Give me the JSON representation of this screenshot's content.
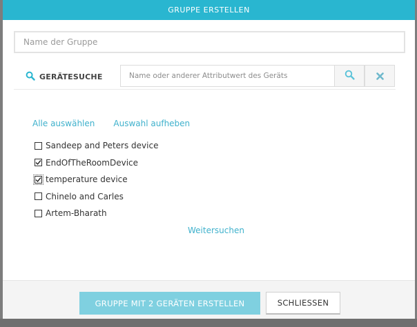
{
  "dialog": {
    "title": "GRUPPE ERSTELLEN",
    "group_name_placeholder": "Name der Gruppe",
    "search": {
      "label": "GERÄTESUCHE",
      "placeholder": "Name oder anderer Attributwert des Geräts",
      "search_icon": "search-icon",
      "clear_icon": "close-icon"
    },
    "select_all_label": "Alle auswählen",
    "deselect_label": "Auswahl aufheben",
    "devices": [
      {
        "name": "Sandeep and Peters device",
        "checked": false
      },
      {
        "name": "EndOfTheRoomDevice",
        "checked": true
      },
      {
        "name": "temperature device",
        "checked": true
      },
      {
        "name": "Chinelo and Carles",
        "checked": false
      },
      {
        "name": "Artem-Bharath",
        "checked": false
      }
    ],
    "more_label": "Weitersuchen",
    "create_button_label": "GRUPPE MIT 2 GERÄTEN ERSTELLEN",
    "close_button_label": "SCHLIESSEN"
  },
  "colors": {
    "accent": "#29b6d0",
    "link": "#3fb1cc",
    "create_button": "#7fd0e0"
  }
}
